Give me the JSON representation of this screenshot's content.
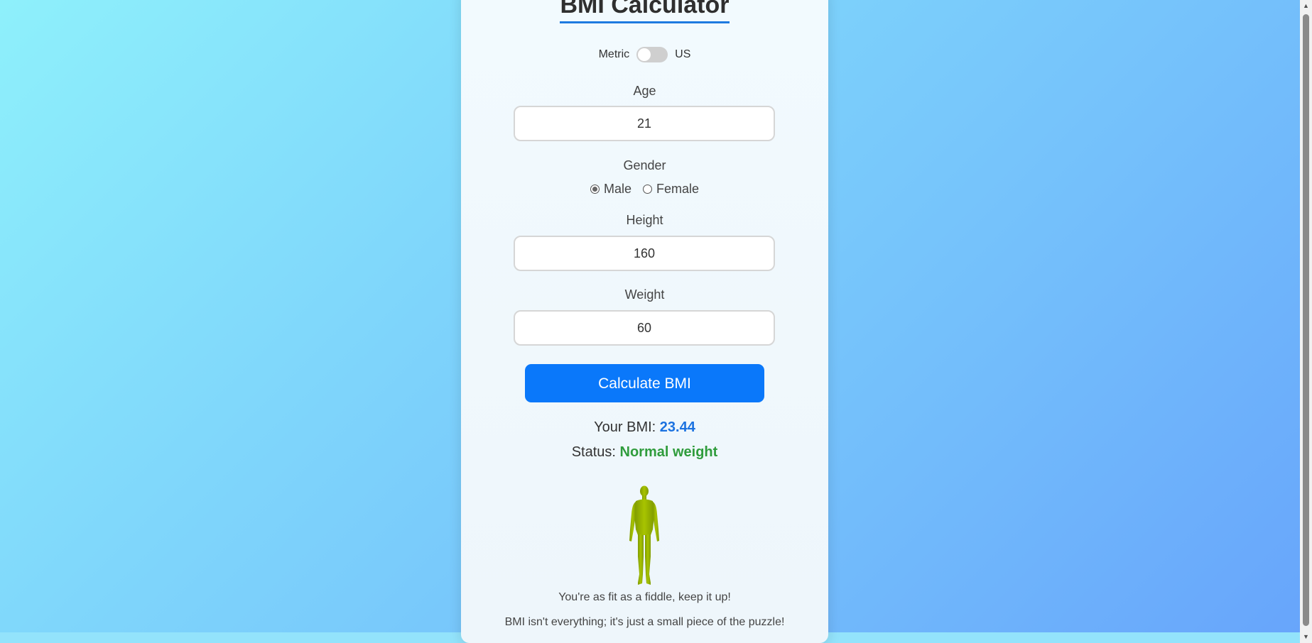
{
  "app": {
    "title": "BMI Calculator"
  },
  "units": {
    "metric_label": "Metric",
    "us_label": "US",
    "selected": "Metric"
  },
  "form": {
    "age_label": "Age",
    "age_value": "21",
    "gender_label": "Gender",
    "gender_male": "Male",
    "gender_female": "Female",
    "gender_selected": "Male",
    "height_label": "Height",
    "height_value": "160",
    "weight_label": "Weight",
    "weight_value": "60"
  },
  "actions": {
    "calculate_label": "Calculate BMI"
  },
  "result": {
    "bmi_prefix": "Your BMI:",
    "bmi_value": "23.44",
    "status_prefix": "Status:",
    "status_value": "Normal weight",
    "figure_icon": "human-figure-icon",
    "message_1": "You're as fit as a fiddle, keep it up!",
    "message_2": "BMI isn't everything; it's just a small piece of the puzzle!"
  },
  "colors": {
    "accent": "#0a78fa",
    "bmi_value": "#1b72e0",
    "status_normal": "#2f9c3c",
    "figure": "#9ab800"
  }
}
